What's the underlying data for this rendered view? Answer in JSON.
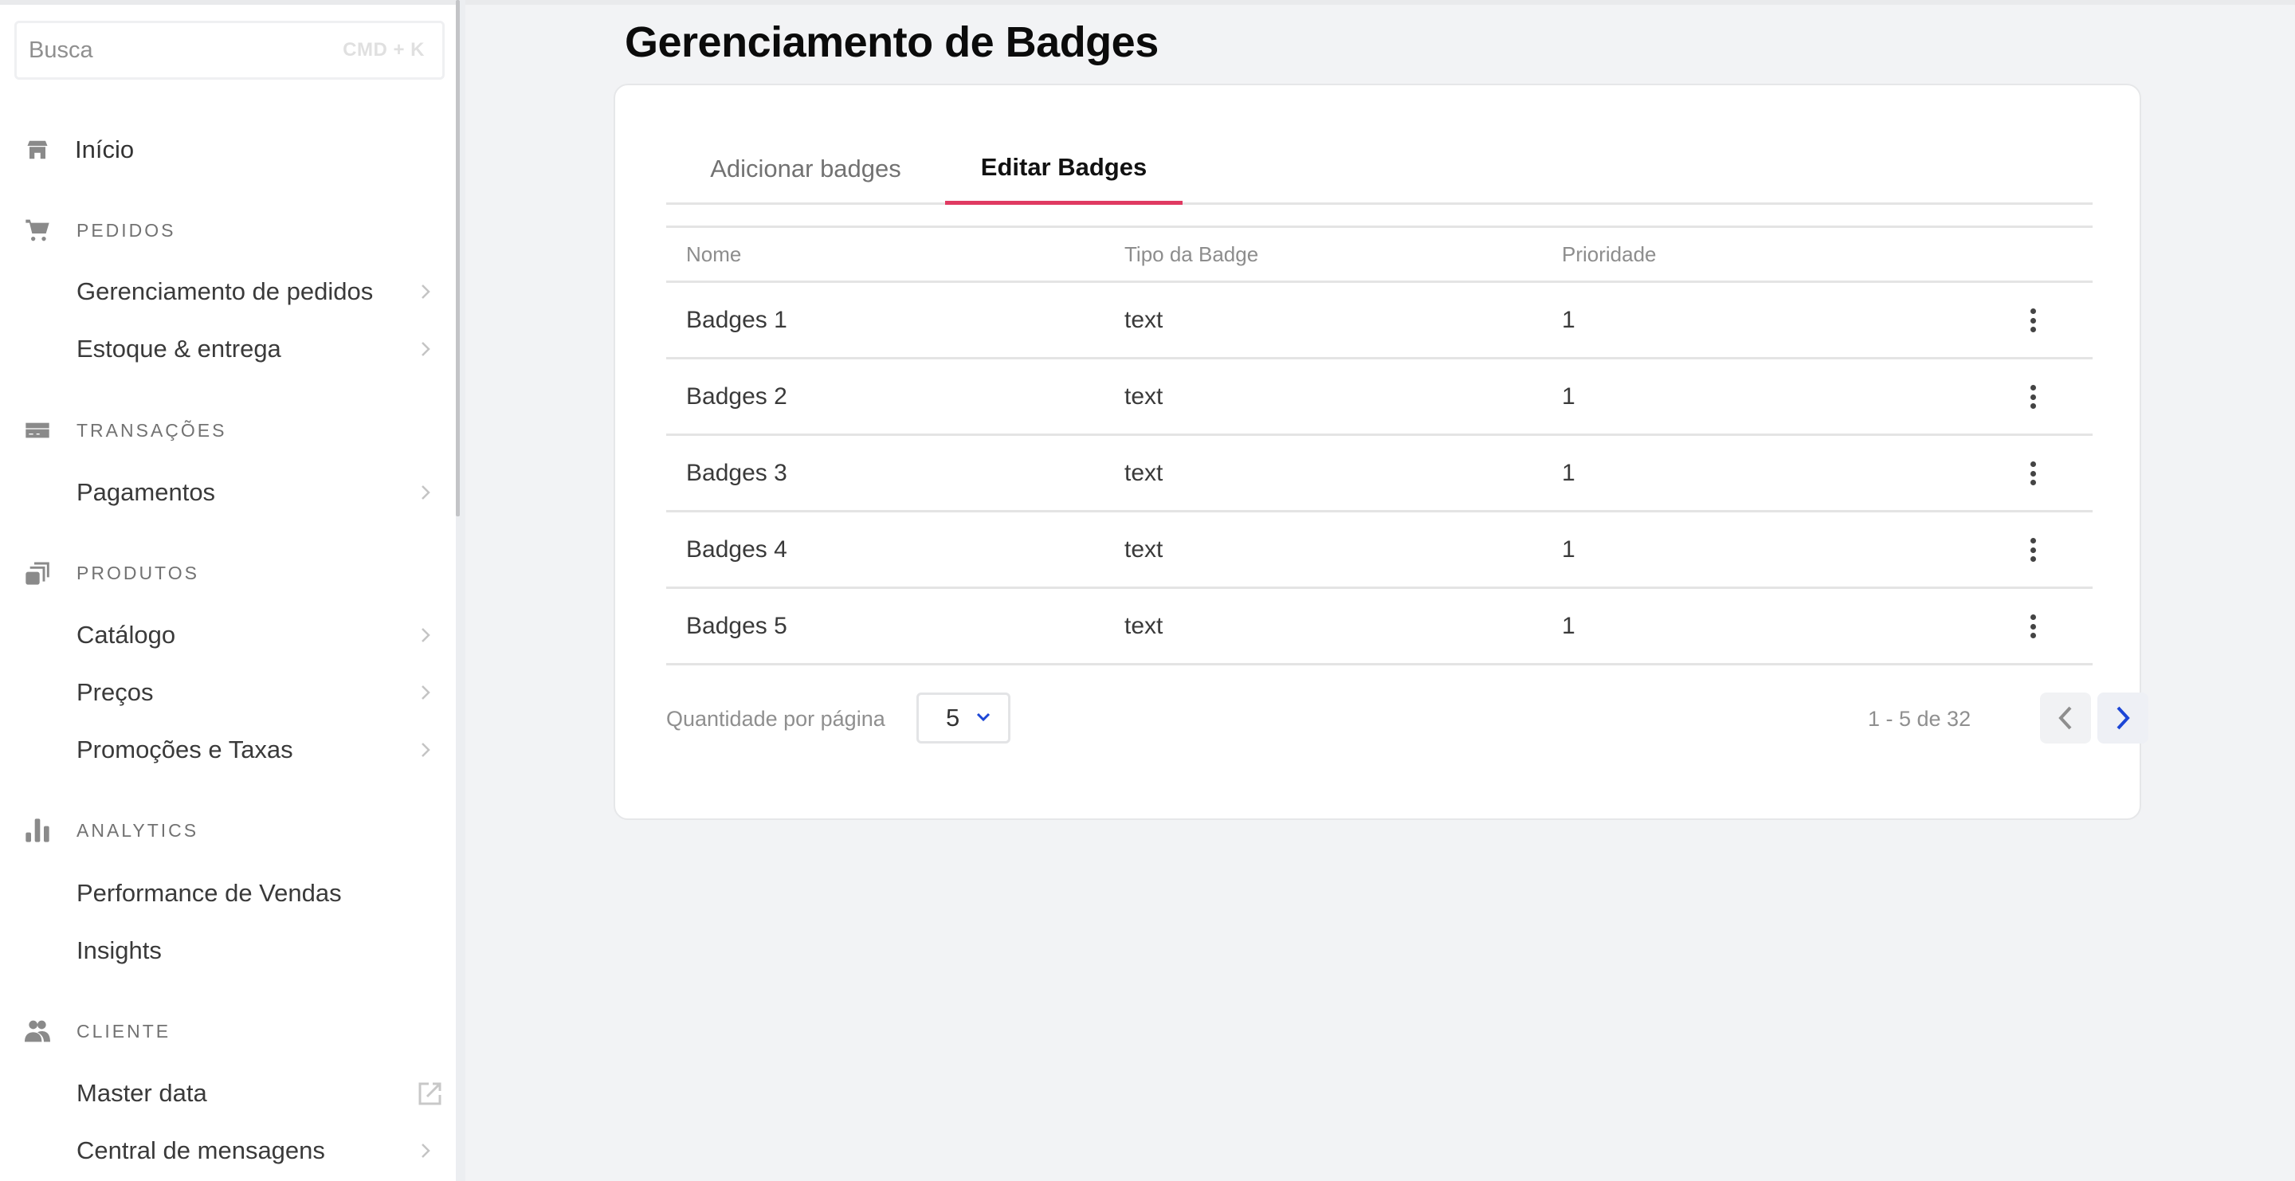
{
  "sidebar": {
    "search": {
      "placeholder": "Busca",
      "shortcut": "CMD + K"
    },
    "home": {
      "label": "Início",
      "icon": "store-icon"
    },
    "sections": [
      {
        "label": "PEDIDOS",
        "icon": "cart-icon",
        "items": [
          {
            "label": "Gerenciamento de pedidos",
            "trailing": "chevron-right-icon"
          },
          {
            "label": "Estoque & entrega",
            "trailing": "chevron-right-icon"
          }
        ]
      },
      {
        "label": "TRANSAÇÕES",
        "icon": "credit-card-icon",
        "items": [
          {
            "label": "Pagamentos",
            "trailing": "chevron-right-icon"
          }
        ]
      },
      {
        "label": "PRODUTOS",
        "icon": "products-stack-icon",
        "items": [
          {
            "label": "Catálogo",
            "trailing": "chevron-right-icon"
          },
          {
            "label": "Preços",
            "trailing": "chevron-right-icon"
          },
          {
            "label": "Promoções e Taxas",
            "trailing": "chevron-right-icon"
          }
        ]
      },
      {
        "label": "ANALYTICS",
        "icon": "bar-chart-icon",
        "items": [
          {
            "label": "Performance de Vendas",
            "trailing": null
          },
          {
            "label": "Insights",
            "trailing": null
          }
        ]
      },
      {
        "label": "CLIENTE",
        "icon": "users-icon",
        "items": [
          {
            "label": "Master data",
            "trailing": "external-link-icon"
          },
          {
            "label": "Central de mensagens",
            "trailing": "chevron-right-icon"
          }
        ]
      }
    ]
  },
  "main": {
    "title": "Gerenciamento de Badges",
    "tabs": [
      {
        "label": "Adicionar badges",
        "active": false
      },
      {
        "label": "Editar Badges",
        "active": true
      }
    ],
    "table": {
      "columns": [
        "Nome",
        "Tipo da Badge",
        "Prioridade"
      ],
      "rows": [
        {
          "name": "Badges 1",
          "type": "text",
          "priority": "1"
        },
        {
          "name": "Badges 2",
          "type": "text",
          "priority": "1"
        },
        {
          "name": "Badges 3",
          "type": "text",
          "priority": "1"
        },
        {
          "name": "Badges 4",
          "type": "text",
          "priority": "1"
        },
        {
          "name": "Badges 5",
          "type": "text",
          "priority": "1"
        }
      ],
      "row_action_icon": "kebab-menu-icon"
    },
    "pagination": {
      "per_page_label": "Quantidade por página",
      "per_page_value": "5",
      "range_text": "1 - 5 de 32",
      "prev_enabled": false,
      "next_enabled": true
    }
  },
  "colors": {
    "accent": "#e03a62",
    "link_blue": "#1c46d6",
    "background": "#f2f3f5"
  }
}
